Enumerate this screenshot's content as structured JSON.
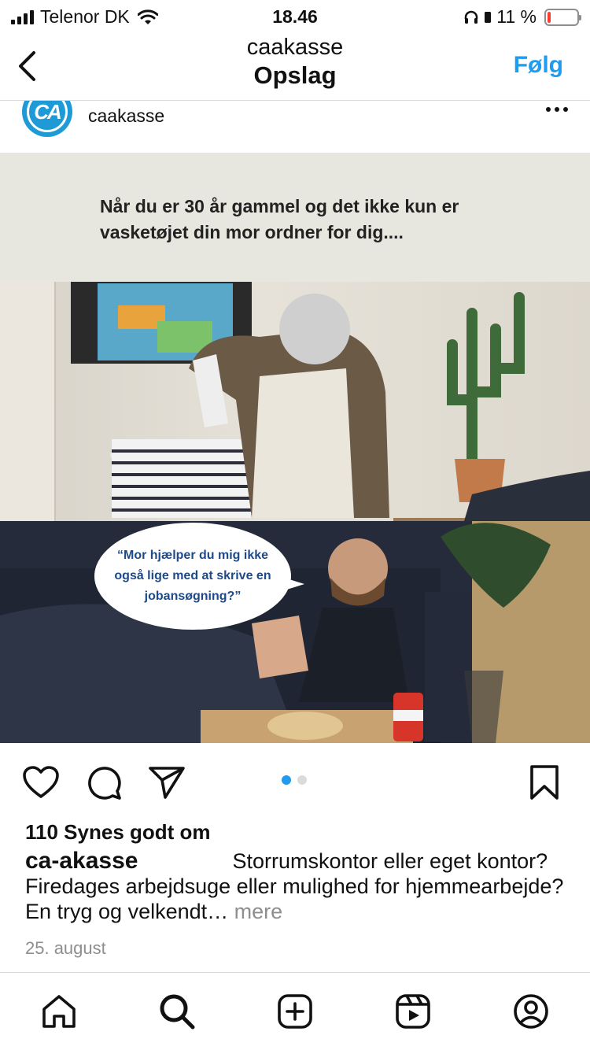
{
  "status_bar": {
    "carrier": "Telenor DK",
    "time": "18.46",
    "battery_percent": "11 %",
    "battery_level": 0.11,
    "battery_color": "#ff3b30"
  },
  "header": {
    "account": "caakasse",
    "subtitle": "Opslag",
    "follow_label": "Følg",
    "accent_color": "#1f9bf0"
  },
  "post": {
    "username": "caakasse",
    "avatar_text": "CA",
    "media": {
      "banner_text": "Når du er 30 år gammel og det ikke kun er vasketøjet din mor ordner for dig....",
      "speech_bubble": "“Mor hjælper du mig ikke også lige med at skrive en jobansøgning?”",
      "carousel_count": 2,
      "carousel_active_index": 0
    },
    "likes": "110 Synes godt om",
    "caption_user": "ca-akasse",
    "caption_text": "Storrumskontor eller eget kontor? Firedages arbejdsuge eller mulighed for hjemmearbejde? En tryg og velkendt…",
    "more_label": "mere",
    "date": "25. august"
  },
  "icons": {
    "back": "chevron-left-icon",
    "more": "more-horizontal-icon",
    "like": "heart-icon",
    "comment": "comment-icon",
    "share": "send-icon",
    "save": "bookmark-icon"
  },
  "tab_bar": [
    "home-icon",
    "search-icon",
    "create-icon",
    "reels-icon",
    "profile-icon"
  ]
}
